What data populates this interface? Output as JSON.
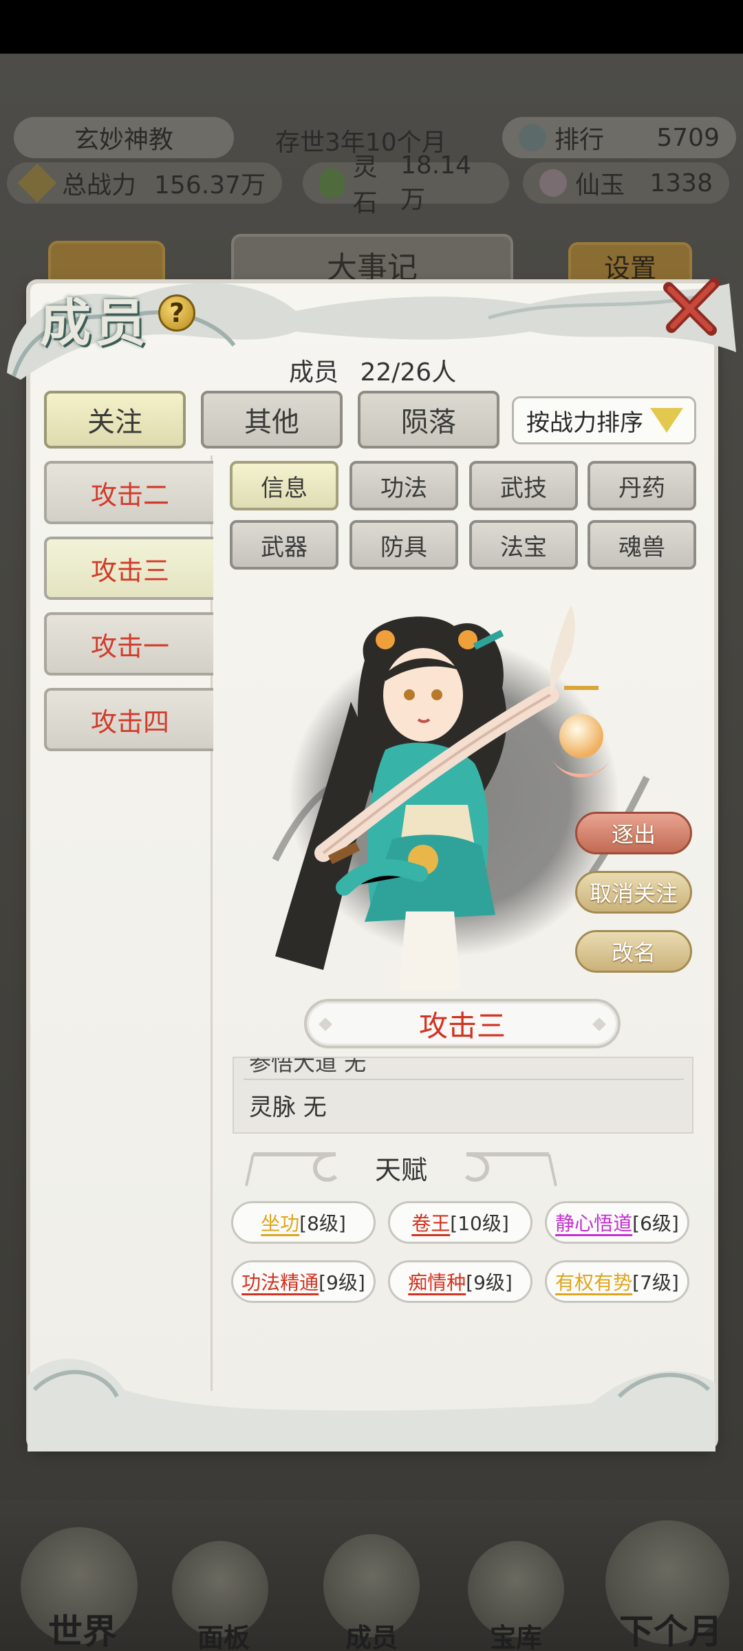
{
  "header": {
    "sect_name": "玄妙神教",
    "age": "存世3年10个月",
    "rank_label": "排行",
    "rank_value": "5709",
    "power_label": "总战力",
    "power_value": "156.37万",
    "spirit_stone_label": "灵石",
    "spirit_stone_value": "18.14万",
    "jade_label": "仙玉",
    "jade_value": "1338"
  },
  "background_tabs": {
    "events": "大事记",
    "settings": "设置"
  },
  "bottom_nav": [
    {
      "label": "世界",
      "icon": "world-icon"
    },
    {
      "label": "面板",
      "icon": "panel-icon"
    },
    {
      "label": "成员",
      "icon": "member-icon"
    },
    {
      "label": "宝库",
      "icon": "treasury-icon"
    },
    {
      "label": "下个月",
      "icon": "next-month-icon"
    }
  ],
  "dialog": {
    "title": "成员",
    "help_icon": "help-icon",
    "close_icon": "close-icon",
    "count_label": "成员",
    "count_value": "22/26人",
    "filters": [
      "关注",
      "其他",
      "陨落"
    ],
    "active_filter": 0,
    "sort_label": "按战力排序"
  },
  "members": [
    {
      "name": "攻击二"
    },
    {
      "name": "攻击三"
    },
    {
      "name": "攻击一"
    },
    {
      "name": "攻击四"
    }
  ],
  "selected_member": 1,
  "detail_tabs": [
    "信息",
    "功法",
    "武技",
    "丹药",
    "武器",
    "防具",
    "法宝",
    "魂兽"
  ],
  "active_detail_tab": 0,
  "actions": {
    "expel": "逐出",
    "unfollow": "取消关注",
    "rename": "改名"
  },
  "character": {
    "name": "攻击三",
    "info_partial": "参悟大道 无",
    "info_row": "灵脉 无"
  },
  "talents_title": "天赋",
  "talents": [
    {
      "name": "坐功",
      "level": "[8级]",
      "color": "#e0a51b"
    },
    {
      "name": "卷王",
      "level": "[10级]",
      "color": "#d2321f"
    },
    {
      "name": "静心悟道",
      "level": "[6级]",
      "color": "#c42fd0"
    },
    {
      "name": "功法精通",
      "level": "[9级]",
      "color": "#d2321f"
    },
    {
      "name": "痴情种",
      "level": "[9级]",
      "color": "#d2321f"
    },
    {
      "name": "有权有势",
      "level": "[7级]",
      "color": "#e0a51b"
    }
  ]
}
